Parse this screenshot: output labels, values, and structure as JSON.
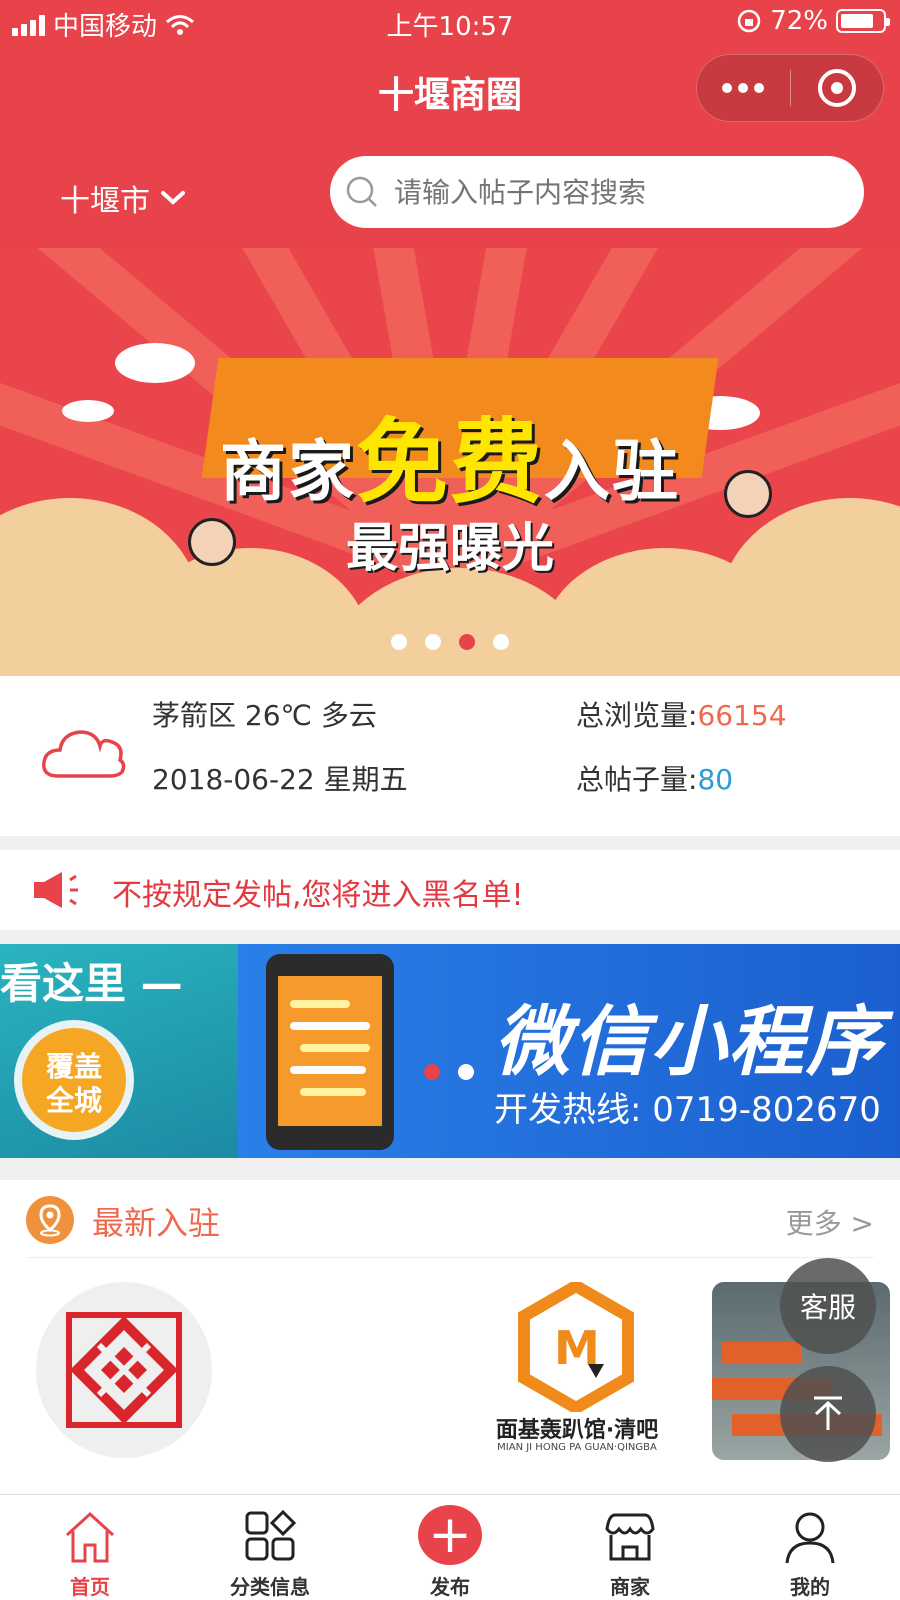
{
  "status_bar": {
    "carrier": "中国移动",
    "time": "上午10:57",
    "battery": "72%"
  },
  "nav": {
    "title": "十堰商圈"
  },
  "search_row": {
    "city": "十堰市",
    "search_placeholder": "请输入帖子内容搜索"
  },
  "banner": {
    "headline_pre": "商家",
    "headline_hl": "免费",
    "headline_post": "入驻",
    "subline": "最强曝光",
    "active_slide": 3,
    "slide_count": 4
  },
  "weather": {
    "location_line": "茅箭区 26℃ 多云",
    "date_line": "2018-06-22 星期五",
    "views_label": "总浏览量:",
    "views_value": "66154",
    "posts_label": "总帖子量:",
    "posts_value": "80"
  },
  "notice": {
    "text": "不按规定发帖,您将进入黑名单!"
  },
  "banner2": {
    "left_head": "看这里 —",
    "badge_text_1": "覆盖",
    "badge_text_2": "全城",
    "big_text": "微信小程序",
    "hotline": "开发热线: 0719-802670",
    "active_slide": 1,
    "slide_count": 2
  },
  "newest": {
    "title": "最新入驻",
    "more": "更多 >",
    "shop2_name": "面基轰趴馆·清吧",
    "shop2_sub": "MIAN JI HONG PA GUAN·QINGBA"
  },
  "float": {
    "service": "客服",
    "top": "↑"
  },
  "tabbar": {
    "tabs": [
      {
        "label": "首页",
        "icon": "home-icon",
        "active": true
      },
      {
        "label": "分类信息",
        "icon": "category-icon",
        "active": false
      },
      {
        "label": "发布",
        "icon": "plus-icon",
        "active": false
      },
      {
        "label": "商家",
        "icon": "shop-icon",
        "active": false
      },
      {
        "label": "我的",
        "icon": "user-icon",
        "active": false
      }
    ]
  },
  "colors": {
    "brand_red": "#e8434a",
    "views_orange": "#f0694c",
    "posts_blue": "#2e9ad6"
  }
}
